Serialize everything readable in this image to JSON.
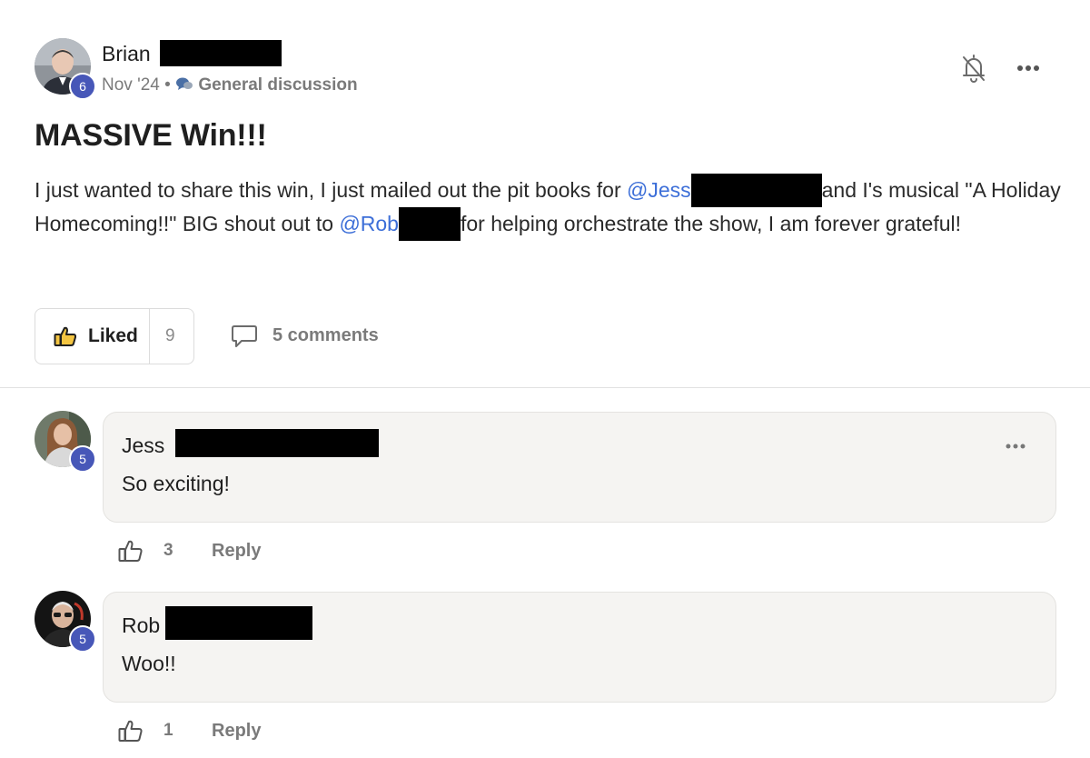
{
  "post": {
    "author_first": "Brian",
    "author_level": "6",
    "date": "Nov '24",
    "separator": "•",
    "category": "General discussion",
    "title": "MASSIVE Win!!!",
    "body": {
      "part1": "I just wanted to share this win, I just mailed out the pit books for ",
      "mention1": "@Jess",
      "part2": "and I's musical \"A Holiday Homecoming!!\" BIG shout out to ",
      "mention2": "@Rob",
      "part3": "for helping orchestrate the show, I am forever grateful!"
    },
    "like_label": "Liked",
    "like_count": "9",
    "comments_label": "5 comments"
  },
  "comments": [
    {
      "name": "Jess",
      "level": "5",
      "text": "So exciting!",
      "likes": "3",
      "reply_label": "Reply"
    },
    {
      "name": "Rob",
      "level": "5",
      "text": "Woo!!",
      "likes": "1",
      "reply_label": "Reply"
    }
  ],
  "icons": {
    "bell_muted": "bell-off-icon",
    "more": "more-horizontal-icon",
    "thumbs_up": "thumbs-up-icon",
    "comment": "comment-bubble-icon",
    "category": "speech-bubbles-icon"
  },
  "colors": {
    "mention": "#3d6fd8",
    "level_badge": "#4757b8",
    "bubble_bg": "#f5f4f2"
  }
}
